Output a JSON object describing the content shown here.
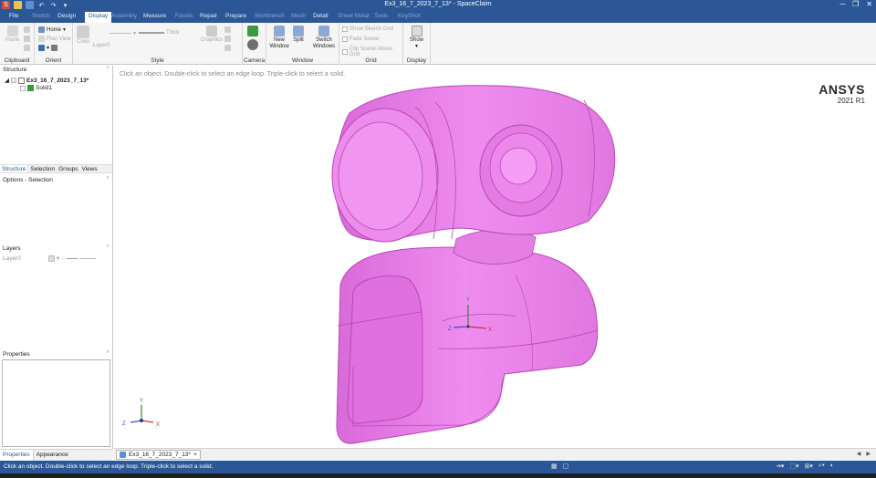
{
  "window": {
    "title": "Ex3_16_7_2023_7_13* - SpaceClaim",
    "controls": [
      "minimize",
      "restore",
      "close"
    ]
  },
  "menu": {
    "tabs": [
      {
        "label": "File",
        "state": "normal"
      },
      {
        "label": "Sketch",
        "state": "dim"
      },
      {
        "label": "Design",
        "state": "normal"
      },
      {
        "label": "Display",
        "state": "active"
      },
      {
        "label": "Assembly",
        "state": "dim"
      },
      {
        "label": "Measure",
        "state": "normal"
      },
      {
        "label": "Facets",
        "state": "dim"
      },
      {
        "label": "Repair",
        "state": "normal"
      },
      {
        "label": "Prepare",
        "state": "normal"
      },
      {
        "label": "Workbench",
        "state": "dim"
      },
      {
        "label": "Mesh",
        "state": "dim"
      },
      {
        "label": "Detail",
        "state": "normal"
      },
      {
        "label": "Sheet Metal",
        "state": "dim"
      },
      {
        "label": "Tools",
        "state": "dim"
      },
      {
        "label": "KeyShot",
        "state": "dim"
      }
    ]
  },
  "ribbon": {
    "clipboard": {
      "group": "Clipboard",
      "paste": "Paste"
    },
    "orient": {
      "group": "Orient",
      "home": "Home",
      "plan_view": "Plan View"
    },
    "style": {
      "group": "Style",
      "color": "Color",
      "layer": "Layer0",
      "line": "Thick",
      "graphics": "Graphics"
    },
    "camera": {
      "group": "Camera"
    },
    "window": {
      "group": "Window",
      "new_window": "New Window",
      "split": "Split",
      "switch_windows": "Switch Windows"
    },
    "grid": {
      "group": "Grid",
      "show_sketch_grid": "Show Sketch Grid",
      "fade_scene": "Fade Scene",
      "clip_scene": "Clip Scene Above Grid"
    },
    "display": {
      "group": "Display",
      "show": "Show"
    }
  },
  "left": {
    "structure_header": "Structure",
    "tree": {
      "root": "Ex3_16_7_2023_7_13*",
      "child": "Solid1"
    },
    "tabs": [
      "Structure",
      "Selection",
      "Groups",
      "Views"
    ],
    "options_header": "Options - Selection",
    "layers_header": "Layers",
    "layer_row": "Layer0",
    "properties_header": "Properties",
    "bottom_tabs": [
      "Properties",
      "Appearance"
    ]
  },
  "viewport": {
    "hint": "Click an object. Double-click to select an edge loop. Triple-click to select a solid.",
    "brand_name": "ANSYS",
    "brand_version": "2021 R1",
    "model_color": "#ee82ee",
    "model_edge": "#b548b5",
    "triad_labels": {
      "x": "X",
      "y": "Y",
      "z": "Z"
    }
  },
  "doc_tab": {
    "label": "Ex3_16_7_2023_7_13*",
    "close": "×"
  },
  "status": {
    "message": "Click an object. Double-click to select an edge loop. Triple-click to select a solid."
  },
  "colors": {
    "accent": "#2b5797",
    "ribbon_bg": "#f5f5f5"
  }
}
